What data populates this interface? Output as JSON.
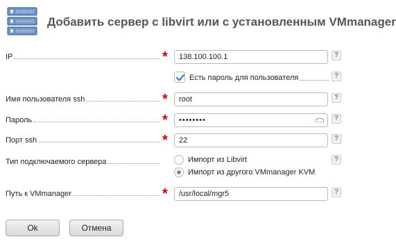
{
  "header": {
    "title": "Добавить сервер с libvirt или с установленным VMmanager",
    "icon": "server-stack-icon"
  },
  "form": {
    "ip": {
      "label": "IP",
      "value": "138.100.100.1",
      "required": true
    },
    "has_password": {
      "label": "Есть пароль для пользователя",
      "checked": true
    },
    "ssh_user": {
      "label": "Имя пользователя ssh",
      "value": "root",
      "required": true
    },
    "password": {
      "label": "Пароль",
      "value": "••••••••",
      "required": true
    },
    "ssh_port": {
      "label": "Порт ssh",
      "value": "22",
      "required": true
    },
    "server_type": {
      "label": "Тип подключаемого сервера",
      "options": [
        "Импорт из Libvirt",
        "Импорт из другого VMmanager KVM"
      ],
      "selected": "Импорт из другого VMmanager KVM"
    },
    "vmmanager_path": {
      "label": "Путь к VMmanager",
      "value": "/usr/local/mgr5",
      "required": true
    }
  },
  "help_glyph": "?",
  "required_glyph": "*",
  "buttons": {
    "ok": "Ok",
    "cancel": "Отмена"
  },
  "colors": {
    "required": "#cc0000",
    "check": "#4a7ab5",
    "help": "#5d87b8"
  }
}
